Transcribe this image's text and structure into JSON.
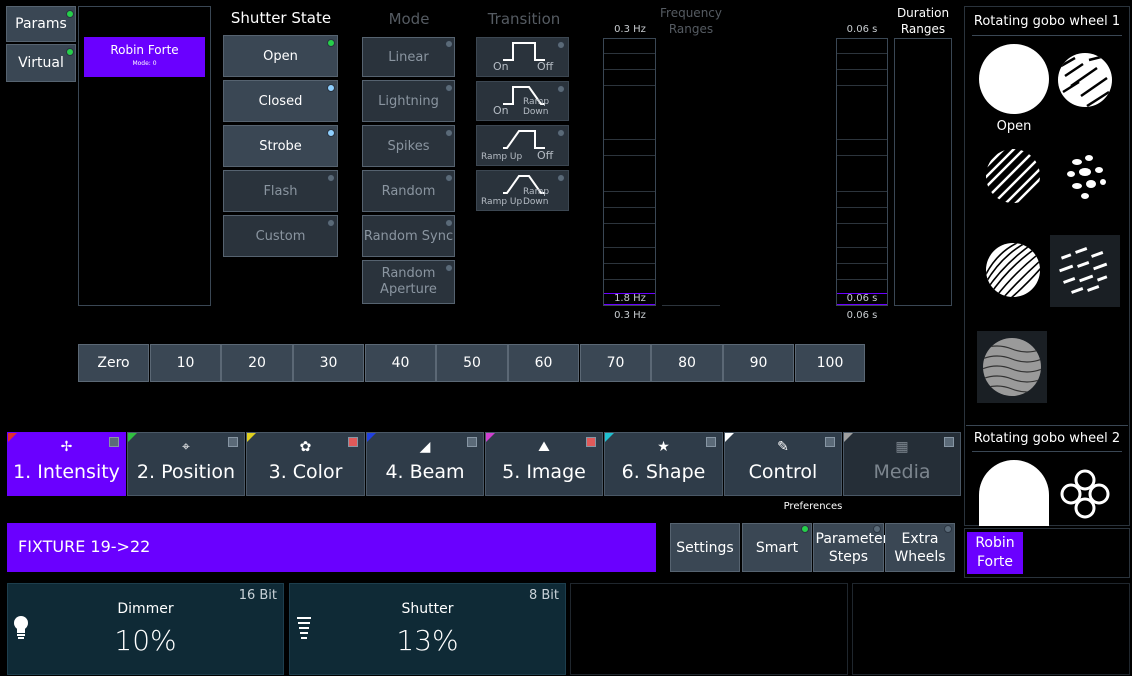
{
  "left_tabs": {
    "params": "Params",
    "virtual": "Virtual"
  },
  "fixture": {
    "name": "Robin Forte",
    "mode": "Mode: 0"
  },
  "shutter_state": {
    "title": "Shutter State",
    "items": [
      "Open",
      "Closed",
      "Strobe",
      "Flash",
      "Custom"
    ]
  },
  "mode": {
    "title": "Mode",
    "items": [
      "Linear",
      "Lightning",
      "Spikes",
      "Random",
      "Random Sync",
      "Random Aperture"
    ]
  },
  "transition": {
    "title": "Transition",
    "items": [
      {
        "left": "On",
        "right": "Off"
      },
      {
        "left": "On",
        "right": "Ramp Down"
      },
      {
        "left": "Ramp Up",
        "right": "Off"
      },
      {
        "left": "Ramp Up",
        "right": "Ramp Down"
      }
    ]
  },
  "frequency": {
    "title": "Frequency Ranges",
    "top_value": "0.3 Hz",
    "current_value": "1.8 Hz",
    "bottom_value": "0.3 Hz"
  },
  "duration": {
    "title": "Duration Ranges",
    "top_value": "0.06 s",
    "current_value": "0.06 s",
    "bottom_value": "0.06 s"
  },
  "numbers": [
    "Zero",
    "10",
    "20",
    "30",
    "40",
    "50",
    "60",
    "70",
    "80",
    "90",
    "100"
  ],
  "tabs": [
    {
      "label": "1. Intensity",
      "icon": "✢",
      "color": "#e03030",
      "active": true
    },
    {
      "label": "2. Position",
      "icon": "⌖",
      "color": "#30c040",
      "active": false
    },
    {
      "label": "3. Color",
      "icon": "✿",
      "color": "#e0d020",
      "active": false
    },
    {
      "label": "4. Beam",
      "icon": "◢",
      "color": "#2040e0",
      "active": false
    },
    {
      "label": "5. Image",
      "icon": "⛰",
      "color": "#d040d0",
      "active": false
    },
    {
      "label": "6. Shape",
      "icon": "★",
      "color": "#20c0d0",
      "active": false
    },
    {
      "label": "Control",
      "icon": "✎",
      "color": "#ffffff",
      "active": false
    },
    {
      "label": "Media",
      "icon": "▦",
      "color": "#a0a0a0",
      "active": false
    }
  ],
  "command_line": "FIXTURE 19->22",
  "preferences": {
    "title": "Preferences",
    "settings": "Settings",
    "smart": "Smart",
    "parameter_steps": "Parameter Steps",
    "extra_wheels": "Extra Wheels"
  },
  "params": [
    {
      "name": "Dimmer",
      "value": "10%",
      "bits": "16 Bit",
      "icon": "bulb-icon"
    },
    {
      "name": "Shutter",
      "value": "13%",
      "bits": "8 Bit",
      "icon": "shutter-icon"
    }
  ],
  "gobo_wheel_1": {
    "title": "Rotating gobo wheel 1",
    "open_label": "Open"
  },
  "gobo_wheel_2": {
    "title": "Rotating gobo wheel 2"
  },
  "fixture_badge": "Robin Forte",
  "colors": {
    "accent": "#6a00ff",
    "button": "#3a4754",
    "param_card": "#0f2a36"
  }
}
